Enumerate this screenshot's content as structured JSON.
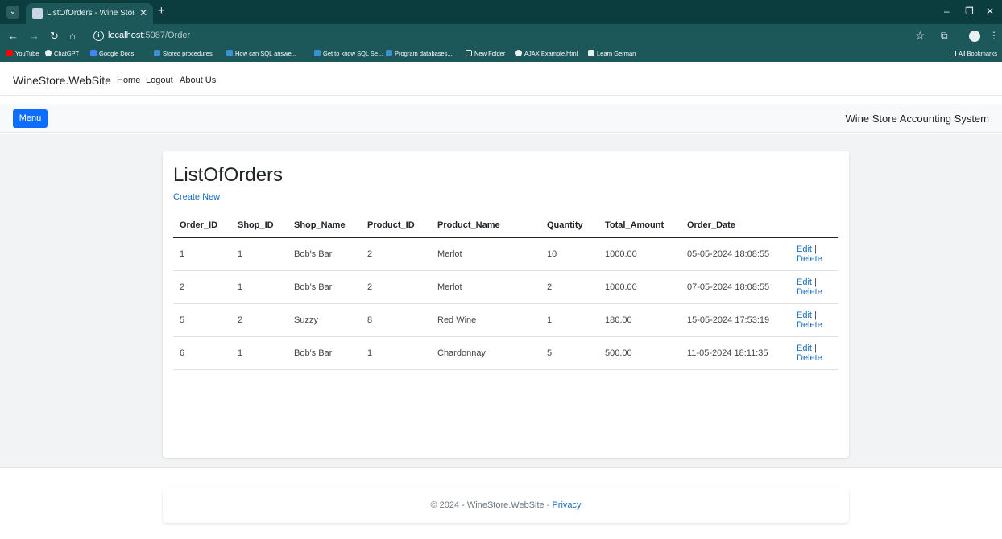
{
  "browser": {
    "tab_title": "ListOfOrders - Wine Store Acco",
    "url_host": "localhost",
    "url_rest": ":5087/Order",
    "bookmarks": [
      "YouTube",
      "ChatGPT",
      "Google Docs",
      "Stored procedures",
      "How can SQL answe...",
      "Get to know SQL Se...",
      "Program databases...",
      "New Folder",
      "AJAX Example.html",
      "Learn German"
    ],
    "all_bookmarks": "All Bookmarks"
  },
  "nav": {
    "brand": "WineStore.WebSite",
    "links": [
      "Home",
      "Logout",
      "About Us"
    ]
  },
  "menubar": {
    "button": "Menu",
    "title": "Wine Store Accounting System"
  },
  "main": {
    "heading": "ListOfOrders",
    "create_new": "Create New",
    "columns": [
      "Order_ID",
      "Shop_ID",
      "Shop_Name",
      "Product_ID",
      "Product_Name",
      "Quantity",
      "Total_Amount",
      "Order_Date"
    ],
    "rows": [
      [
        "1",
        "1",
        "Bob's Bar",
        "2",
        "Merlot",
        "10",
        "1000.00",
        "05-05-2024 18:08:55"
      ],
      [
        "2",
        "1",
        "Bob's Bar",
        "2",
        "Merlot",
        "2",
        "1000.00",
        "07-05-2024 18:08:55"
      ],
      [
        "5",
        "2",
        "Suzzy",
        "8",
        "Red Wine",
        "1",
        "180.00",
        "15-05-2024 17:53:19"
      ],
      [
        "6",
        "1",
        "Bob's Bar",
        "1",
        "Chardonnay",
        "5",
        "500.00",
        "11-05-2024 18:11:35"
      ]
    ],
    "edit_label": "Edit",
    "separator": "|",
    "delete_label": "Delete"
  },
  "footer": {
    "text": "© 2024 - WineStore.WebSite - ",
    "privacy": "Privacy"
  },
  "colors": {
    "chrome_dark": "#0b3d3f",
    "chrome": "#1c5759",
    "primary": "#0d6efd",
    "link": "#1b6ec2"
  }
}
